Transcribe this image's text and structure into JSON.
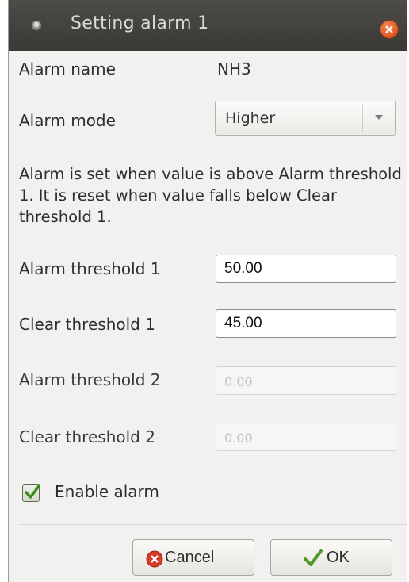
{
  "window": {
    "title": "Setting alarm 1"
  },
  "fields": {
    "alarm_name_label": "Alarm name",
    "alarm_name_value": "NH3",
    "alarm_mode_label": "Alarm mode",
    "alarm_mode_value": "Higher",
    "description": "Alarm is set when value is above Alarm threshold 1. It is reset when value falls below Clear threshold 1.",
    "alarm_threshold_1_label": "Alarm threshold 1",
    "alarm_threshold_1_value": "50.00",
    "clear_threshold_1_label": "Clear threshold 1",
    "clear_threshold_1_value": "45.00",
    "alarm_threshold_2_label": "Alarm threshold 2",
    "alarm_threshold_2_value": "0.00",
    "clear_threshold_2_label": "Clear threshold 2",
    "clear_threshold_2_value": "0.00",
    "enable_alarm_label": "Enable alarm",
    "enable_alarm_checked": true
  },
  "buttons": {
    "cancel_label": "Cancel",
    "ok_label": "OK"
  },
  "icons": {
    "title": "window-menu-icon",
    "close": "close-icon",
    "combo": "chevron-down-icon",
    "checkbox": "checkmark-icon",
    "cancel": "cancel-icon",
    "ok": "checkmark-icon"
  },
  "colors": {
    "titlebar": "#3a3935",
    "close_button": "#e0541f",
    "check_green": "#3d8a1f",
    "cancel_red": "#d63a2a"
  }
}
